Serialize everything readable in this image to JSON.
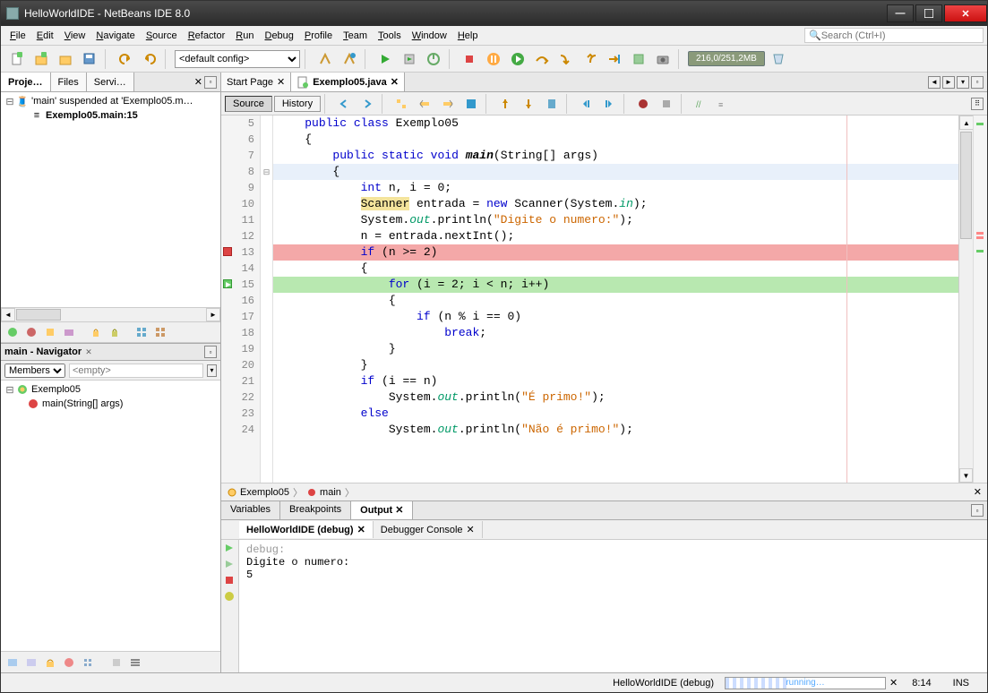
{
  "window": {
    "title": "HelloWorldIDE - NetBeans IDE 8.0"
  },
  "menu": [
    "File",
    "Edit",
    "View",
    "Navigate",
    "Source",
    "Refactor",
    "Run",
    "Debug",
    "Profile",
    "Team",
    "Tools",
    "Window",
    "Help"
  ],
  "search_placeholder": "Search (Ctrl+I)",
  "config": "<default config>",
  "memory": "216,0/251,2MB",
  "left_tabs": [
    "Proje…",
    "Files",
    "Servi…"
  ],
  "debug_tree": {
    "root": "'main' suspended at 'Exemplo05.m…",
    "child": "Exemplo05.main:15"
  },
  "navigator": {
    "title": "main - Navigator",
    "filter": "Members",
    "empty": "<empty>",
    "root": "Exemplo05",
    "method": "main(String[] args)"
  },
  "editor": {
    "tabs": [
      {
        "name": "Start Page",
        "active": false
      },
      {
        "name": "Exemplo05.java",
        "active": true
      }
    ],
    "mode_source": "Source",
    "mode_history": "History",
    "first_line": 5,
    "lines": [
      {
        "n": 5,
        "html": "<span class='kw'>public</span> <span class='kw'>class</span> Exemplo05",
        "ind": 1
      },
      {
        "n": 6,
        "html": "{",
        "ind": 1
      },
      {
        "n": 7,
        "html": "<span class='kw'>public</span> <span class='kw'>static</span> <span class='kw'>void</span> <span class='method-i'><b>main</b></span>(String[] args)",
        "ind": 2
      },
      {
        "n": 8,
        "html": "{",
        "ind": 2,
        "cursor": true,
        "fold": "⊟"
      },
      {
        "n": 9,
        "html": "<span class='kw'>int</span> n, i = 0;",
        "ind": 3
      },
      {
        "n": 10,
        "html": "<span class='warn'>Scanner</span> entrada = <span class='kw'>new</span> Scanner(System.<span class='field'>in</span>);",
        "ind": 3
      },
      {
        "n": 11,
        "html": "System.<span class='field'>out</span>.println(<span class='str'>\"Digite o numero:\"</span>);",
        "ind": 3
      },
      {
        "n": 12,
        "html": "n = entrada.nextInt();",
        "ind": 3
      },
      {
        "n": 13,
        "html": "<span class='kw'>if</span> (n &gt;= 2)",
        "ind": 3,
        "bp": true
      },
      {
        "n": 14,
        "html": "{",
        "ind": 3
      },
      {
        "n": 15,
        "html": "<span class='kw'>for</span> (i = 2; i &lt; n; i++)",
        "ind": 4,
        "exec": true
      },
      {
        "n": 16,
        "html": "{",
        "ind": 4
      },
      {
        "n": 17,
        "html": "<span class='kw'>if</span> (n % i == 0)",
        "ind": 5
      },
      {
        "n": 18,
        "html": "<span class='kw'>break</span>;",
        "ind": 6
      },
      {
        "n": 19,
        "html": "}",
        "ind": 4
      },
      {
        "n": 20,
        "html": "}",
        "ind": 3
      },
      {
        "n": 21,
        "html": "<span class='kw'>if</span> (i == n)",
        "ind": 3
      },
      {
        "n": 22,
        "html": "System.<span class='field'>out</span>.println(<span class='str'>\"É primo!\"</span>);",
        "ind": 4
      },
      {
        "n": 23,
        "html": "<span class='kw'>else</span>",
        "ind": 3
      },
      {
        "n": 24,
        "html": "System.<span class='field'>out</span>.println(<span class='str'>\"Não é primo!\"</span>);",
        "ind": 4
      }
    ],
    "breadcrumb": [
      "Exemplo05",
      "main"
    ]
  },
  "bottom_tabs": [
    "Variables",
    "Breakpoints",
    "Output"
  ],
  "output": {
    "tabs": [
      "HelloWorldIDE (debug)",
      "Debugger Console"
    ],
    "lines": [
      "debug:",
      "Digite o numero:",
      "5"
    ]
  },
  "status": {
    "task": "HelloWorldIDE (debug)",
    "progress": "running…",
    "pos": "8:14",
    "mode": "INS"
  }
}
